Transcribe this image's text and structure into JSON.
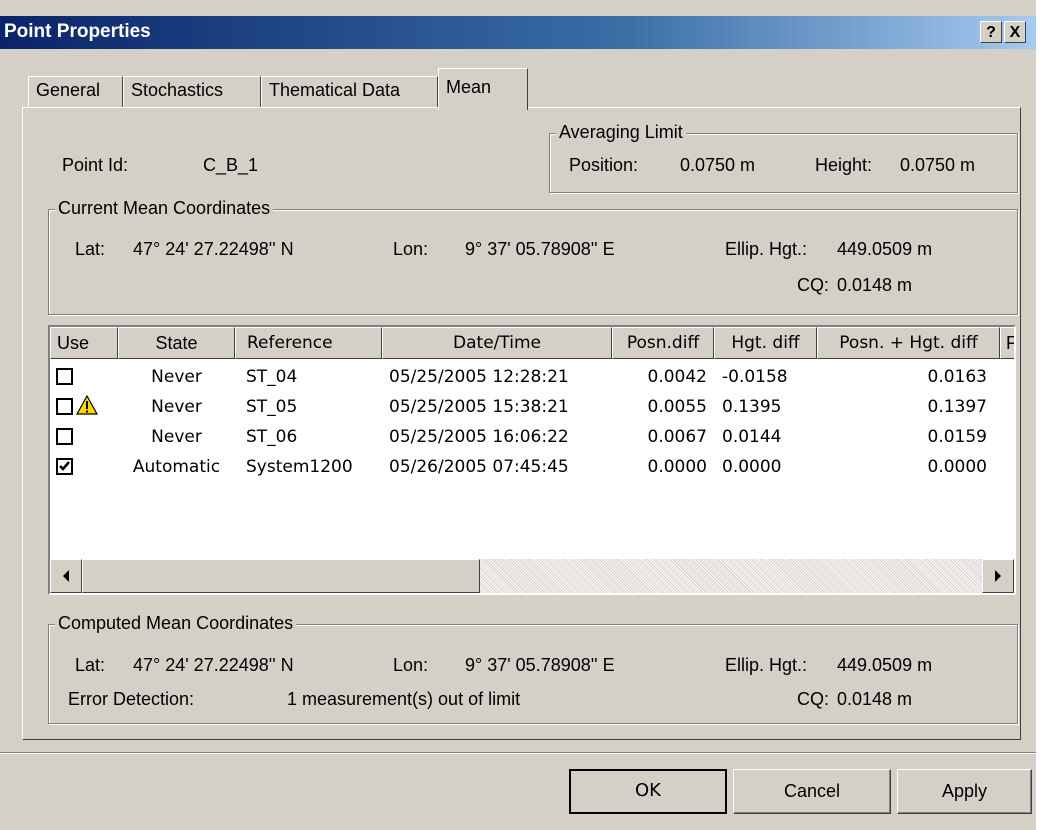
{
  "window": {
    "title": "Point Properties",
    "help_label": "?",
    "close_label": "X"
  },
  "tabs": [
    {
      "label": "General"
    },
    {
      "label": "Stochastics"
    },
    {
      "label": "Thematical Data"
    },
    {
      "label": "Mean"
    }
  ],
  "point": {
    "label": "Point Id:",
    "value": "C_B_1"
  },
  "averaging_limit": {
    "legend": "Averaging Limit",
    "position_label": "Position:",
    "position_value": "0.0750 m",
    "height_label": "Height:",
    "height_value": "0.0750 m"
  },
  "current_mean": {
    "legend": "Current Mean Coordinates",
    "lat_label": "Lat:",
    "lat_value": "47° 24' 27.22498'' N",
    "lon_label": "Lon:",
    "lon_value": "9° 37' 05.78908'' E",
    "hgt_label": "Ellip. Hgt.:",
    "hgt_value": "449.0509 m",
    "cq_label": "CQ:",
    "cq_value": "0.0148 m"
  },
  "table": {
    "columns": [
      "Use",
      "State",
      "Reference",
      "Date/Time",
      "Posn.diff",
      "Hgt. diff",
      "Posn. + Hgt. diff",
      "F"
    ],
    "rows": [
      {
        "checked": false,
        "warning": false,
        "state": "Never",
        "reference": "ST_04",
        "datetime": "05/25/2005 12:28:21",
        "posn_diff": "0.0042",
        "hgt_diff": "-0.0158",
        "total_diff": "0.0163"
      },
      {
        "checked": false,
        "warning": true,
        "state": "Never",
        "reference": "ST_05",
        "datetime": "05/25/2005 15:38:21",
        "posn_diff": "0.0055",
        "hgt_diff": "0.1395",
        "total_diff": "0.1397"
      },
      {
        "checked": false,
        "warning": false,
        "state": "Never",
        "reference": "ST_06",
        "datetime": "05/25/2005 16:06:22",
        "posn_diff": "0.0067",
        "hgt_diff": "0.0144",
        "total_diff": "0.0159"
      },
      {
        "checked": true,
        "warning": false,
        "state": "Automatic",
        "reference": "System1200",
        "datetime": "05/26/2005 07:45:45",
        "posn_diff": "0.0000",
        "hgt_diff": "0.0000",
        "total_diff": "0.0000"
      }
    ]
  },
  "computed_mean": {
    "legend": "Computed Mean Coordinates",
    "lat_label": "Lat:",
    "lat_value": "47° 24' 27.22498'' N",
    "lon_label": "Lon:",
    "lon_value": "9° 37' 05.78908'' E",
    "hgt_label": "Ellip. Hgt.:",
    "hgt_value": "449.0509 m",
    "error_label": "Error Detection:",
    "error_value": "1 measurement(s) out of limit",
    "cq_label": "CQ:",
    "cq_value": "0.0148 m"
  },
  "buttons": {
    "ok": "OK",
    "cancel": "Cancel",
    "apply": "Apply"
  }
}
